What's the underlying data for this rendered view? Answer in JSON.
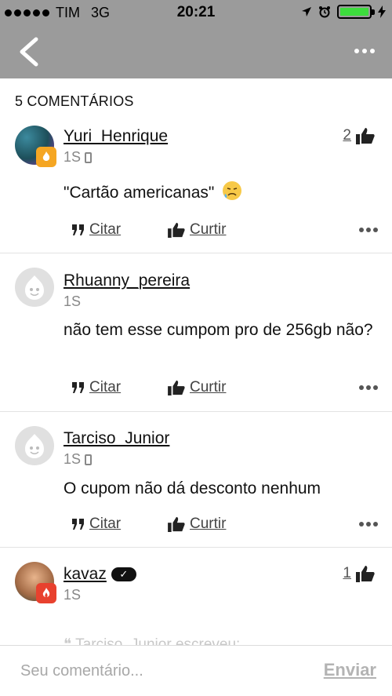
{
  "status_bar": {
    "carrier": "TIM",
    "network": "3G",
    "time": "20:21"
  },
  "comments_header": "5 COMENTÁRIOS",
  "actions": {
    "quote_label": "Citar",
    "like_label": "Curtir"
  },
  "comments": [
    {
      "username": "Yuri_Henrique",
      "time": "1S",
      "device": "phone-icon",
      "likes": "2",
      "text": "\"Cartão americanas\""
    },
    {
      "username": "Rhuanny_pereira",
      "time": "1S",
      "text": "não tem esse cumpom pro de 256gb não?"
    },
    {
      "username": "Tarciso_Junior",
      "time": "1S",
      "device": "phone-icon",
      "text": "O cupom não dá desconto nenhum"
    },
    {
      "username": "kavaz",
      "time": "1S",
      "likes": "1",
      "quoted_partial": "Tarciso_Junior escreveu:"
    }
  ],
  "input": {
    "placeholder": "Seu comentário...",
    "send_label": "Enviar"
  },
  "colors": {
    "navbar": "#9b9b9b",
    "badge_orange": "#f5a623",
    "badge_red": "#e8412e",
    "battery_green": "#3ddc3d"
  }
}
